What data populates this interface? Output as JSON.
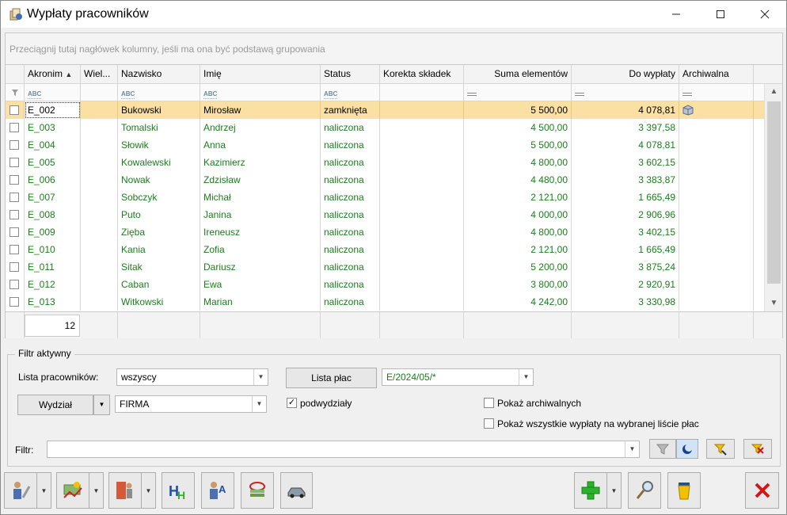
{
  "window": {
    "title": "Wypłaty pracowników"
  },
  "group_panel": {
    "hint": "Przeciągnij tutaj nagłówek kolumny, jeśli ma ona być podstawą grupowania"
  },
  "grid": {
    "columns": {
      "akronim": "Akronim",
      "wiel": "Wiel...",
      "nazwisko": "Nazwisko",
      "imie": "Imię",
      "status": "Status",
      "korekta": "Korekta składek",
      "suma": "Suma elementów",
      "dowyplaty": "Do wypłaty",
      "archiwalna": "Archiwalna"
    },
    "filter_row_abc": "ABC",
    "rows": [
      {
        "akronim": "E_002",
        "nazwisko": "Bukowski",
        "imie": "Mirosław",
        "status": "zamknięta",
        "suma": "5 500,00",
        "dowyplaty": "4 078,81",
        "archiwalna_icon": "archive-box-icon"
      },
      {
        "akronim": "E_003",
        "nazwisko": "Tomalski",
        "imie": "Andrzej",
        "status": "naliczona",
        "suma": "4 500,00",
        "dowyplaty": "3 397,58"
      },
      {
        "akronim": "E_004",
        "nazwisko": "Słowik",
        "imie": "Anna",
        "status": "naliczona",
        "suma": "5 500,00",
        "dowyplaty": "4 078,81"
      },
      {
        "akronim": "E_005",
        "nazwisko": "Kowalewski",
        "imie": "Kazimierz",
        "status": "naliczona",
        "suma": "4 800,00",
        "dowyplaty": "3 602,15"
      },
      {
        "akronim": "E_006",
        "nazwisko": "Nowak",
        "imie": "Zdzisław",
        "status": "naliczona",
        "suma": "4 480,00",
        "dowyplaty": "3 383,87"
      },
      {
        "akronim": "E_007",
        "nazwisko": "Sobczyk",
        "imie": "Michał",
        "status": "naliczona",
        "suma": "2 121,00",
        "dowyplaty": "1 665,49"
      },
      {
        "akronim": "E_008",
        "nazwisko": "Puto",
        "imie": "Janina",
        "status": "naliczona",
        "suma": "4 000,00",
        "dowyplaty": "2 906,96"
      },
      {
        "akronim": "E_009",
        "nazwisko": "Zięba",
        "imie": "Ireneusz",
        "status": "naliczona",
        "suma": "4 800,00",
        "dowyplaty": "3 402,15"
      },
      {
        "akronim": "E_010",
        "nazwisko": "Kania",
        "imie": "Zofia",
        "status": "naliczona",
        "suma": "2 121,00",
        "dowyplaty": "1 665,49"
      },
      {
        "akronim": "E_011",
        "nazwisko": "Sitak",
        "imie": "Dariusz",
        "status": "naliczona",
        "suma": "5 200,00",
        "dowyplaty": "3 875,24"
      },
      {
        "akronim": "E_012",
        "nazwisko": "Caban",
        "imie": "Ewa",
        "status": "naliczona",
        "suma": "3 800,00",
        "dowyplaty": "2 920,91"
      },
      {
        "akronim": "E_013",
        "nazwisko": "Witkowski",
        "imie": "Marian",
        "status": "naliczona",
        "suma": "4 242,00",
        "dowyplaty": "3 330,98"
      }
    ],
    "footer_count": "12"
  },
  "filter": {
    "legend": "Filtr aktywny",
    "lista_pracownikow_label": "Lista pracowników:",
    "lista_pracownikow_value": "wszyscy",
    "lista_plac_button": "Lista płac",
    "lista_plac_value": "E/2024/05/*",
    "wydzial_button": "Wydział",
    "wydzial_value": "FIRMA",
    "podwydzialy_label": "podwydziały",
    "podwydzialy_checked": "✓",
    "pokaz_archiwalnych_label": "Pokaż archiwalnych",
    "pokaz_wszystkie_label": "Pokaż wszystkie wypłaty na wybranej liście płac",
    "filtr_label": "Filtr:",
    "filtr_value": ""
  },
  "colors": {
    "green_text": "#1c7d1c",
    "selected_row": "#fbe0a3",
    "delete_red": "#d01818",
    "add_green": "#2cb32c"
  }
}
